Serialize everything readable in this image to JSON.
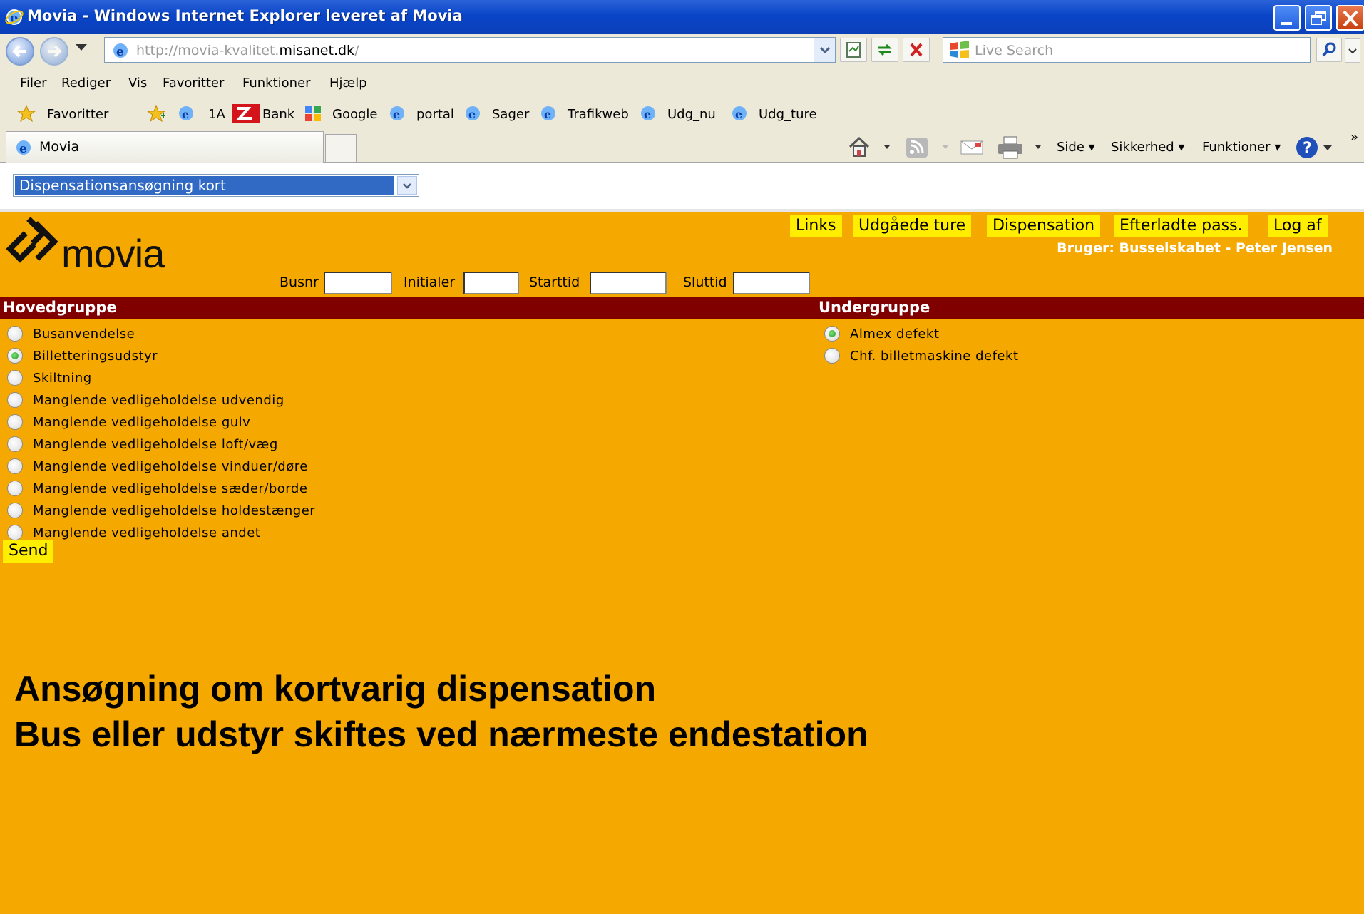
{
  "window": {
    "title": "Movia - Windows Internet Explorer leveret af Movia"
  },
  "address_bar": {
    "url_prefix": "http://movia-kvalitet.",
    "url_host": "misanet.dk",
    "url_suffix": "/",
    "search_placeholder": "Live Search"
  },
  "menu": [
    "Filer",
    "Rediger",
    "Vis",
    "Favoritter",
    "Funktioner",
    "Hjælp"
  ],
  "favorites_bar": {
    "favorites_label": "Favoritter",
    "links": [
      "1A",
      "Bank",
      "Google",
      "portal",
      "Sager",
      "Trafikweb",
      "Udg_nu",
      "Udg_ture"
    ]
  },
  "tabs": {
    "active": "Movia"
  },
  "command_bar": {
    "side": "Side",
    "sikkerhed": "Sikkerhed",
    "funktioner": "Funktioner"
  },
  "page": {
    "form_select_value": "Dispensationsansøgning kort",
    "logo_text": "movia",
    "top_links": [
      "Links",
      "Udgåede ture",
      "Dispensation",
      "Efterladte pass.",
      "Log af"
    ],
    "user": "Bruger: Busselskabet - Peter Jensen",
    "fields": {
      "busnr": "Busnr",
      "initialer": "Initialer",
      "starttid": "Starttid",
      "sluttid": "Sluttid"
    },
    "hovedgruppe_title": "Hovedgruppe",
    "undergruppe_title": "Undergruppe",
    "hovedgruppe": [
      {
        "label": "Busanvendelse",
        "checked": false
      },
      {
        "label": "Billetteringsudstyr",
        "checked": true
      },
      {
        "label": "Skiltning",
        "checked": false
      },
      {
        "label": "Manglende vedligeholdelse udvendig",
        "checked": false
      },
      {
        "label": "Manglende vedligeholdelse gulv",
        "checked": false
      },
      {
        "label": "Manglende vedligeholdelse loft/væg",
        "checked": false
      },
      {
        "label": "Manglende vedligeholdelse vinduer/døre",
        "checked": false
      },
      {
        "label": "Manglende vedligeholdelse sæder/borde",
        "checked": false
      },
      {
        "label": "Manglende vedligeholdelse holdestænger",
        "checked": false
      },
      {
        "label": "Manglende vedligeholdelse andet",
        "checked": false
      }
    ],
    "undergruppe": [
      {
        "label": "Almex defekt",
        "checked": true
      },
      {
        "label": "Chf. billetmaskine defekt",
        "checked": false
      }
    ],
    "send_label": "Send",
    "caption_line1": "Ansøgning om kortvarig dispensation",
    "caption_line2": "Bus eller udstyr skiftes ved nærmeste endestation"
  },
  "colors": {
    "page_background": "#f5a800",
    "group_header": "#800000",
    "button_yellow": "#ffee00",
    "title_bar": "#0a45c8"
  }
}
